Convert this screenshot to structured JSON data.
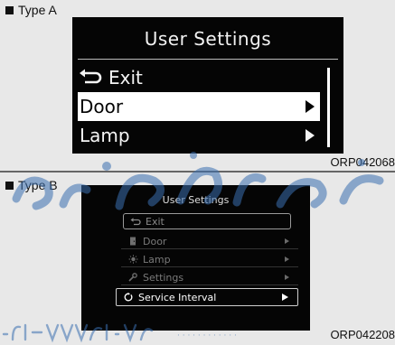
{
  "panel_a": {
    "type_label": "Type A",
    "screen": {
      "title": "User Settings",
      "items": [
        {
          "label": "Exit",
          "icon": "return-arrow-icon",
          "selected": false,
          "has_arrow": false
        },
        {
          "label": "Door",
          "icon": "",
          "selected": true,
          "has_arrow": true
        },
        {
          "label": "Lamp",
          "icon": "",
          "selected": false,
          "has_arrow": true
        }
      ]
    },
    "code": "ORP042068"
  },
  "panel_b": {
    "type_label": "Type B",
    "screen": {
      "title": "User Settings",
      "items": [
        {
          "label": "Exit",
          "icon": "return-arrow-icon",
          "selected": false,
          "has_arrow": false
        },
        {
          "label": "Door",
          "icon": "door-icon",
          "selected": false,
          "has_arrow": true
        },
        {
          "label": "Lamp",
          "icon": "lamp-icon",
          "selected": false,
          "has_arrow": true
        },
        {
          "label": "Settings",
          "icon": "wrench-icon",
          "selected": false,
          "has_arrow": true
        },
        {
          "label": "Service Interval",
          "icon": "service-icon",
          "selected": true,
          "has_arrow": true
        }
      ]
    },
    "code": "ORP042208"
  },
  "colors": {
    "page_bg": "#e6e6e6",
    "screen_bg": "#050505",
    "highlight": "#ffffff",
    "watermark": "#3a6fb0"
  }
}
